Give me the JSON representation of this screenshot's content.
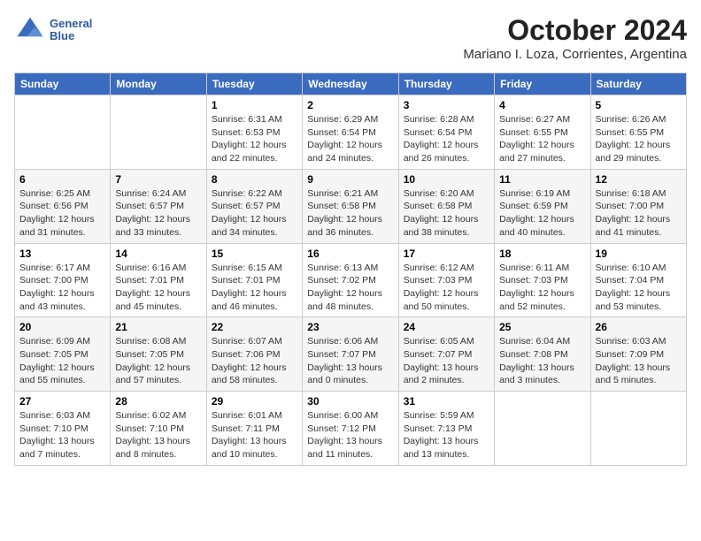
{
  "header": {
    "logo_line1": "General",
    "logo_line2": "Blue",
    "title": "October 2024",
    "subtitle": "Mariano I. Loza, Corrientes, Argentina"
  },
  "weekdays": [
    "Sunday",
    "Monday",
    "Tuesday",
    "Wednesday",
    "Thursday",
    "Friday",
    "Saturday"
  ],
  "weeks": [
    [
      {
        "day": "",
        "info": ""
      },
      {
        "day": "",
        "info": ""
      },
      {
        "day": "1",
        "info": "Sunrise: 6:31 AM\nSunset: 6:53 PM\nDaylight: 12 hours\nand 22 minutes."
      },
      {
        "day": "2",
        "info": "Sunrise: 6:29 AM\nSunset: 6:54 PM\nDaylight: 12 hours\nand 24 minutes."
      },
      {
        "day": "3",
        "info": "Sunrise: 6:28 AM\nSunset: 6:54 PM\nDaylight: 12 hours\nand 26 minutes."
      },
      {
        "day": "4",
        "info": "Sunrise: 6:27 AM\nSunset: 6:55 PM\nDaylight: 12 hours\nand 27 minutes."
      },
      {
        "day": "5",
        "info": "Sunrise: 6:26 AM\nSunset: 6:55 PM\nDaylight: 12 hours\nand 29 minutes."
      }
    ],
    [
      {
        "day": "6",
        "info": "Sunrise: 6:25 AM\nSunset: 6:56 PM\nDaylight: 12 hours\nand 31 minutes."
      },
      {
        "day": "7",
        "info": "Sunrise: 6:24 AM\nSunset: 6:57 PM\nDaylight: 12 hours\nand 33 minutes."
      },
      {
        "day": "8",
        "info": "Sunrise: 6:22 AM\nSunset: 6:57 PM\nDaylight: 12 hours\nand 34 minutes."
      },
      {
        "day": "9",
        "info": "Sunrise: 6:21 AM\nSunset: 6:58 PM\nDaylight: 12 hours\nand 36 minutes."
      },
      {
        "day": "10",
        "info": "Sunrise: 6:20 AM\nSunset: 6:58 PM\nDaylight: 12 hours\nand 38 minutes."
      },
      {
        "day": "11",
        "info": "Sunrise: 6:19 AM\nSunset: 6:59 PM\nDaylight: 12 hours\nand 40 minutes."
      },
      {
        "day": "12",
        "info": "Sunrise: 6:18 AM\nSunset: 7:00 PM\nDaylight: 12 hours\nand 41 minutes."
      }
    ],
    [
      {
        "day": "13",
        "info": "Sunrise: 6:17 AM\nSunset: 7:00 PM\nDaylight: 12 hours\nand 43 minutes."
      },
      {
        "day": "14",
        "info": "Sunrise: 6:16 AM\nSunset: 7:01 PM\nDaylight: 12 hours\nand 45 minutes."
      },
      {
        "day": "15",
        "info": "Sunrise: 6:15 AM\nSunset: 7:01 PM\nDaylight: 12 hours\nand 46 minutes."
      },
      {
        "day": "16",
        "info": "Sunrise: 6:13 AM\nSunset: 7:02 PM\nDaylight: 12 hours\nand 48 minutes."
      },
      {
        "day": "17",
        "info": "Sunrise: 6:12 AM\nSunset: 7:03 PM\nDaylight: 12 hours\nand 50 minutes."
      },
      {
        "day": "18",
        "info": "Sunrise: 6:11 AM\nSunset: 7:03 PM\nDaylight: 12 hours\nand 52 minutes."
      },
      {
        "day": "19",
        "info": "Sunrise: 6:10 AM\nSunset: 7:04 PM\nDaylight: 12 hours\nand 53 minutes."
      }
    ],
    [
      {
        "day": "20",
        "info": "Sunrise: 6:09 AM\nSunset: 7:05 PM\nDaylight: 12 hours\nand 55 minutes."
      },
      {
        "day": "21",
        "info": "Sunrise: 6:08 AM\nSunset: 7:05 PM\nDaylight: 12 hours\nand 57 minutes."
      },
      {
        "day": "22",
        "info": "Sunrise: 6:07 AM\nSunset: 7:06 PM\nDaylight: 12 hours\nand 58 minutes."
      },
      {
        "day": "23",
        "info": "Sunrise: 6:06 AM\nSunset: 7:07 PM\nDaylight: 13 hours\nand 0 minutes."
      },
      {
        "day": "24",
        "info": "Sunrise: 6:05 AM\nSunset: 7:07 PM\nDaylight: 13 hours\nand 2 minutes."
      },
      {
        "day": "25",
        "info": "Sunrise: 6:04 AM\nSunset: 7:08 PM\nDaylight: 13 hours\nand 3 minutes."
      },
      {
        "day": "26",
        "info": "Sunrise: 6:03 AM\nSunset: 7:09 PM\nDaylight: 13 hours\nand 5 minutes."
      }
    ],
    [
      {
        "day": "27",
        "info": "Sunrise: 6:03 AM\nSunset: 7:10 PM\nDaylight: 13 hours\nand 7 minutes."
      },
      {
        "day": "28",
        "info": "Sunrise: 6:02 AM\nSunset: 7:10 PM\nDaylight: 13 hours\nand 8 minutes."
      },
      {
        "day": "29",
        "info": "Sunrise: 6:01 AM\nSunset: 7:11 PM\nDaylight: 13 hours\nand 10 minutes."
      },
      {
        "day": "30",
        "info": "Sunrise: 6:00 AM\nSunset: 7:12 PM\nDaylight: 13 hours\nand 11 minutes."
      },
      {
        "day": "31",
        "info": "Sunrise: 5:59 AM\nSunset: 7:13 PM\nDaylight: 13 hours\nand 13 minutes."
      },
      {
        "day": "",
        "info": ""
      },
      {
        "day": "",
        "info": ""
      }
    ]
  ]
}
